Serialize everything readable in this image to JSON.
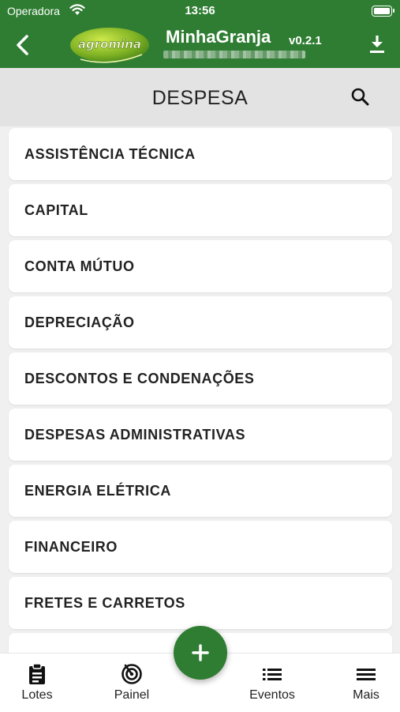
{
  "status_bar": {
    "carrier": "Operadora",
    "time": "13:56"
  },
  "app_bar": {
    "logo_text": "agromina",
    "title": "MinhaGranja",
    "version": "v0.2.1"
  },
  "section": {
    "title": "DESPESA"
  },
  "items": [
    "ASSISTÊNCIA TÉCNICA",
    "CAPITAL",
    "CONTA MÚTUO",
    "DEPRECIAÇÃO",
    "DESCONTOS E CONDENAÇÕES",
    "DESPESAS ADMINISTRATIVAS",
    "ENERGIA ELÉTRICA",
    "FINANCEIRO",
    "FRETES E CARRETOS",
    ""
  ],
  "bottom_nav": {
    "lotes": "Lotes",
    "painel": "Painel",
    "eventos": "Eventos",
    "mais": "Mais"
  },
  "colors": {
    "brand_green": "#2f7d32",
    "header_gray": "#e3e3e3",
    "background": "#f0f0f0"
  },
  "icons": {
    "back": "chevron-left-icon",
    "download": "download-icon",
    "search": "search-icon",
    "lotes": "clipboard-icon",
    "painel": "radar-icon",
    "eventos": "list-icon",
    "mais": "menu-icon",
    "fab": "plus-icon"
  }
}
